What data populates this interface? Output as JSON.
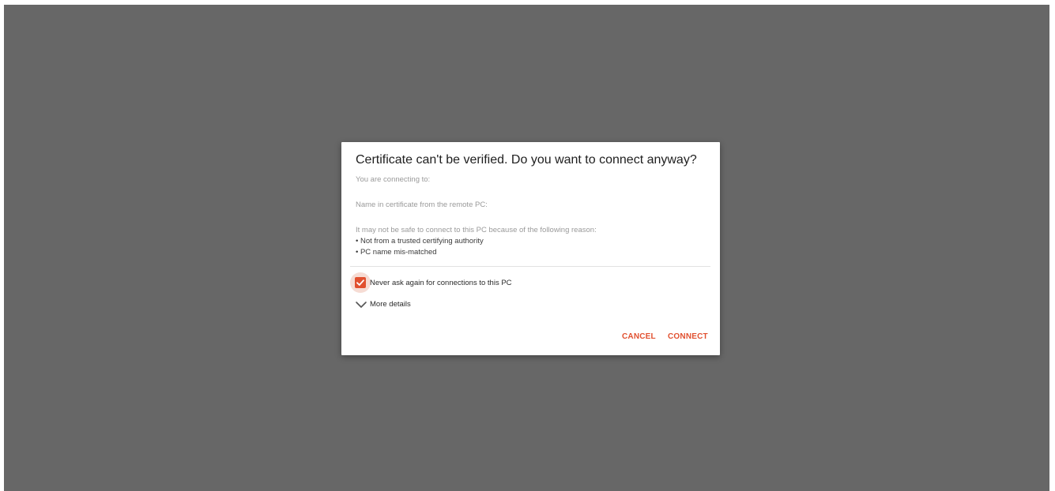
{
  "dialog": {
    "title": "Certificate can't be verified. Do you want to connect anyway?",
    "connecting_to": "You are connecting to:",
    "cert_name": "Name in certificate from the remote PC:",
    "reason_intro": "It may not be safe to connect to this PC because of the following reason:",
    "reasons": [
      "• Not from a trusted certifying authority",
      "• PC name mis-matched"
    ],
    "never_ask_label": "Never ask again for connections to this PC",
    "never_ask_checked": true,
    "more_details_label": "More details",
    "cancel_label": "CANCEL",
    "connect_label": "CONNECT"
  },
  "colors": {
    "accent": "#e1502f",
    "backdrop": "#676767"
  },
  "icons": {
    "checkbox": "checkmark-icon",
    "expand": "chevron-down-icon"
  }
}
